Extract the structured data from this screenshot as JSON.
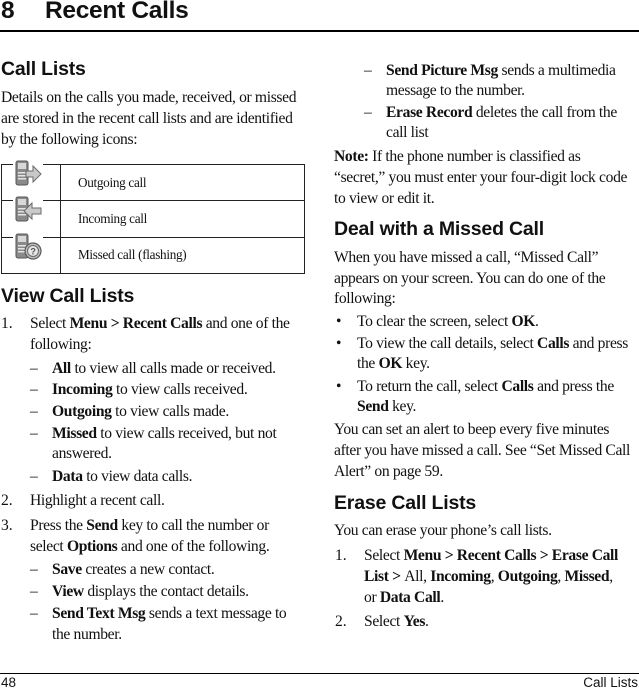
{
  "chapter": {
    "number": "8",
    "title": "Recent Calls"
  },
  "call_lists": {
    "heading": "Call Lists",
    "intro_lines": [
      "Details on the calls you made, received, or missed",
      "are stored in the recent call lists and are identified",
      "by the following icons:"
    ],
    "icons": [
      {
        "icon": "outgoing-call-icon",
        "label": "Outgoing call"
      },
      {
        "icon": "incoming-call-icon",
        "label": "Incoming call"
      },
      {
        "icon": "missed-call-icon",
        "label": "Missed call (flashing)"
      }
    ]
  },
  "view_call_lists": {
    "heading": "View Call Lists",
    "step1": {
      "num": "1.",
      "pre": "Select ",
      "bold": "Menu > Recent Calls",
      "post": " and one of the",
      "line2": "following:",
      "options": [
        {
          "bold": "All",
          "text": " to view all calls made or received."
        },
        {
          "bold": "Incoming",
          "text": " to view calls received."
        },
        {
          "bold": "Outgoing",
          "text": " to view calls made."
        },
        {
          "bold": "Missed",
          "text": " to view calls received, but not",
          "line2": "answered."
        },
        {
          "bold": "Data",
          "text": " to view data calls."
        }
      ]
    },
    "step2": {
      "num": "2.",
      "text": "Highlight a recent call."
    },
    "step3": {
      "num": "3.",
      "pre": "Press the ",
      "bold1": "Send",
      "mid": " key to call the number or",
      "pre2": "select ",
      "bold2": "Options",
      "post2": " and one of the following.",
      "options": [
        {
          "bold": "Save",
          "text": " creates a new contact."
        },
        {
          "bold": "View",
          "text": " displays the contact details."
        },
        {
          "bold": "Send Text Msg",
          "text": " sends a text message to",
          "line2": "the number."
        },
        {
          "bold": "Send Picture Msg",
          "text": " sends a multimedia",
          "line2": "message to the number."
        },
        {
          "bold": "Erase Record",
          "text": " deletes the call from the",
          "line2": "call list"
        }
      ]
    }
  },
  "note": {
    "label": "Note:",
    "line1": " If the phone number is classified as",
    "line2": "“secret,” you must enter your four-digit lock code",
    "line3": "to view or edit it."
  },
  "missed_call": {
    "heading": "Deal with a Missed Call",
    "intro_lines": [
      "When you have missed a call, “Missed Call”",
      "appears on your screen. You can do one of the",
      "following:"
    ],
    "bullets": [
      {
        "pre": "To clear the screen, select ",
        "bold": "OK",
        "post": "."
      },
      {
        "pre": "To view the call details, select ",
        "bold": "Calls",
        "post": " and press",
        "l2pre": "the ",
        "l2bold": "OK",
        "l2post": " key."
      },
      {
        "pre": "To return the call, select ",
        "bold": "Calls",
        "post": " and press the",
        "l2pre": "",
        "l2bold": "Send",
        "l2post": " key."
      }
    ],
    "alert_lines": [
      "You can set an alert to beep every five minutes",
      "after you have missed a call. See “Set Missed Call",
      "Alert” on page 59."
    ]
  },
  "erase_call_lists": {
    "heading": "Erase Call Lists",
    "intro": "You can erase your phone’s call lists.",
    "step1": {
      "num": "1.",
      "pre": "Select ",
      "bold1": "Menu > Recent Calls > Erase Call",
      "l2bold1": "List > ",
      "l2t1": "All",
      "l2sep1": ", ",
      "l2b2": "Incoming",
      "l2sep2": ", ",
      "l2b3": "Outgoing",
      "l2sep3": ", ",
      "l2b4": "Missed",
      "l2sep4": ",",
      "l3pre": "or ",
      "l3bold": "Data Call",
      "l3post": "."
    },
    "step2": {
      "num": "2.",
      "pre": "Select ",
      "bold": "Yes",
      "post": "."
    }
  },
  "footer": {
    "page_number": "48",
    "section": "Call Lists"
  }
}
